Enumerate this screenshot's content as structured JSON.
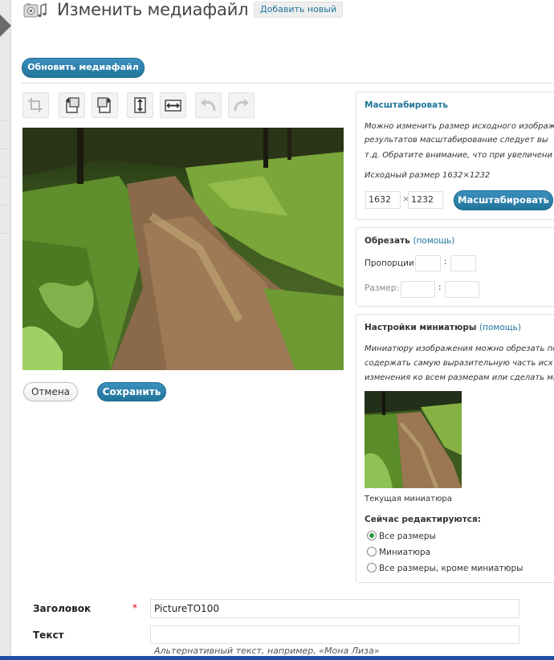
{
  "header": {
    "title": "Изменить медиафайл",
    "add_new_label": "Добавить новый",
    "update_button": "Обновить медиафайл"
  },
  "toolbar": {
    "tools": [
      "crop-icon",
      "rotate-left-icon",
      "rotate-right-icon",
      "flip-vertical-icon",
      "flip-horizontal-icon",
      "undo-icon",
      "redo-icon"
    ]
  },
  "editor": {
    "cancel_label": "Отмена",
    "save_label": "Сохранить"
  },
  "scale_panel": {
    "title": "Масштабировать",
    "desc_line1": "Можно изменить размер исходного изображе",
    "desc_line2": "результатов масштабирование следует вы",
    "desc_line3": "т.д. Обратите внимание, что при увеличени",
    "original_size": "Исходный размер 1632×1232",
    "width_value": "1632",
    "times_sign": "×",
    "height_value": "1232",
    "scale_button": "Масштабировать"
  },
  "crop_panel": {
    "title": "Обрезать",
    "help_link": "(помощь)",
    "aspect_label": "Пропорции:",
    "size_label": "Размер:",
    "separator": ":"
  },
  "thumb_panel": {
    "title": "Настройки миниатюры",
    "help_link": "(помощь)",
    "desc_line1": "Миниатюру изображения можно обрезать по",
    "desc_line2": "содержать самую выразительную часть исх",
    "desc_line3": "изменения ко всем размерам или сделать ми",
    "current_thumb_label": "Текущая миниатюра",
    "editing_label": "Сейчас редактируются:",
    "options": [
      "Все размеры",
      "Миниатюра",
      "Все размеры, кроме миниатюры"
    ],
    "selected_option": "Все размеры"
  },
  "form": {
    "title_label": "Заголовок",
    "required_mark": "*",
    "title_value": "PictureTO100",
    "text_label": "Текст",
    "text_value": "",
    "alt_hint": "Альтернативный текст, например, «Мона Лиза»"
  },
  "colors": {
    "accent_blue": "#21759b",
    "bottom_bar": "#1f4fa3",
    "radio_checked": "#2a9a3a"
  }
}
